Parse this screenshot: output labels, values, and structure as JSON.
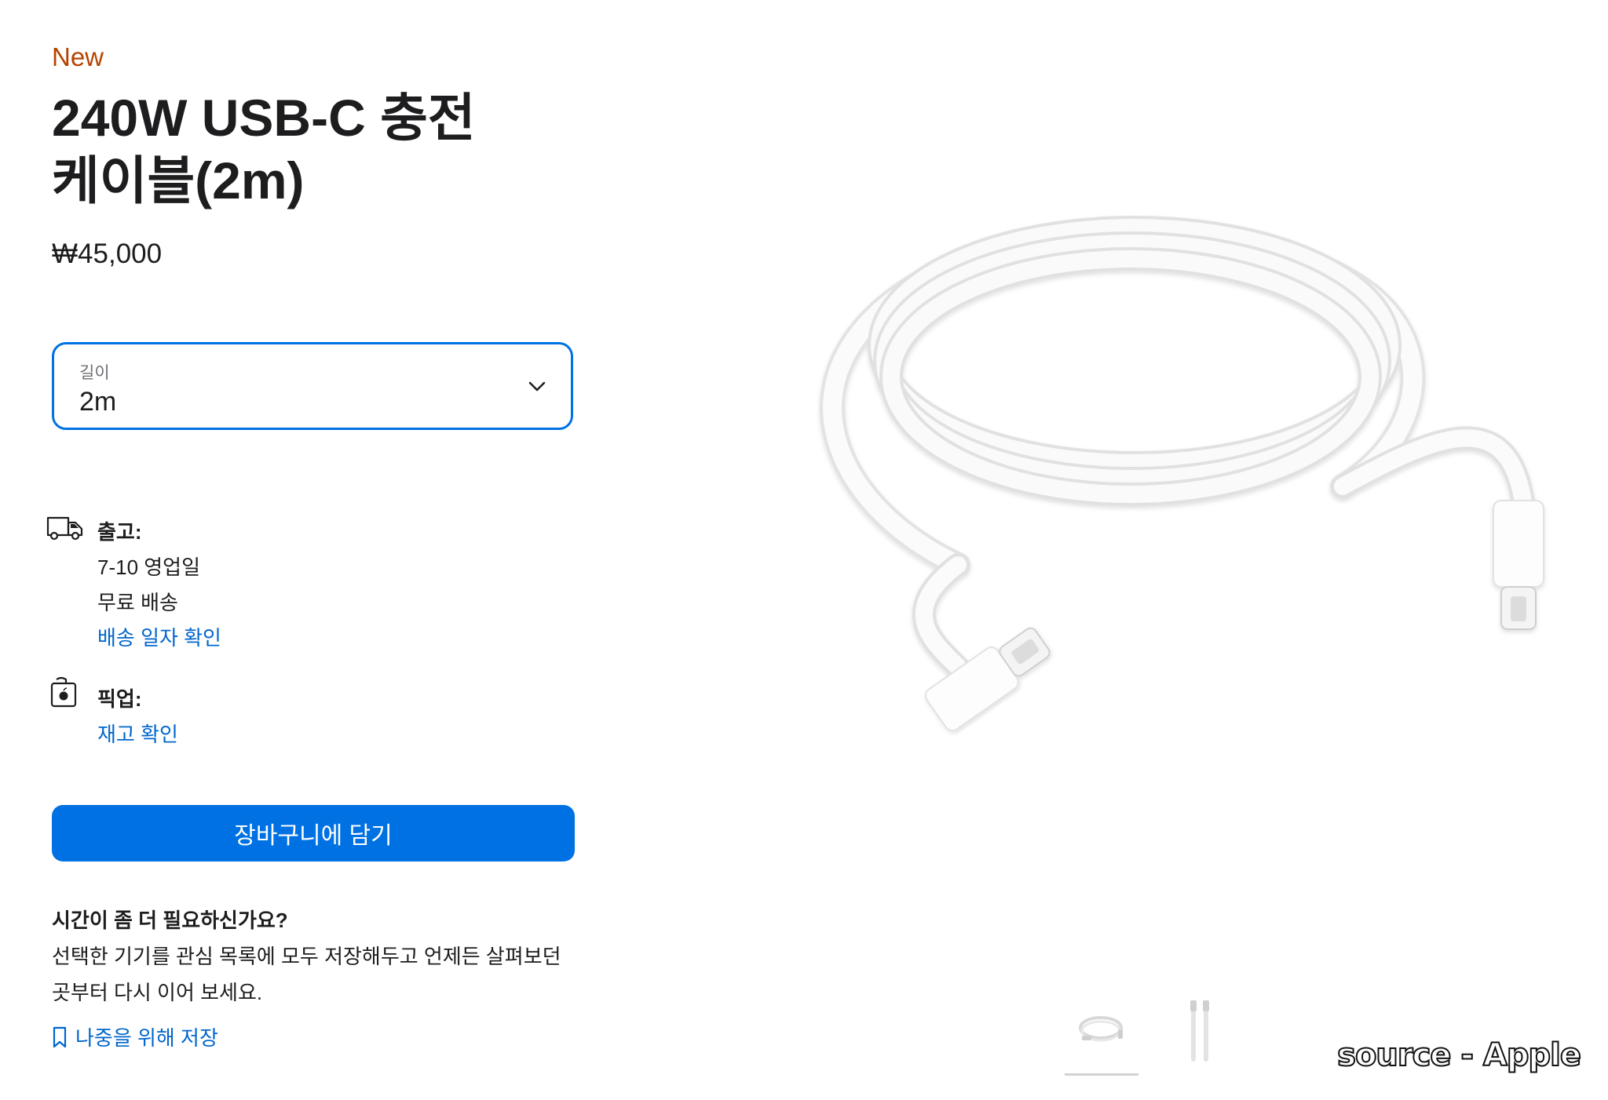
{
  "product": {
    "badge": "New",
    "title_line1": "240W USB-C 충전",
    "title_line2": "케이블(2m)",
    "price": "₩45,000"
  },
  "length_select": {
    "label": "길이",
    "value": "2m"
  },
  "shipping": {
    "title": "출고:",
    "line1": "7-10 영업일",
    "line2": "무료 배송",
    "link": "배송 일자 확인"
  },
  "pickup": {
    "title": "픽업:",
    "link": "재고 확인"
  },
  "cart_button": "장바구니에 담기",
  "save_for_later": {
    "title": "시간이 좀 더 필요하신가요?",
    "desc_line1": "선택한 기기를 관심 목록에 모두 저장해두고 언제든 살펴보던",
    "desc_line2": "곳부터 다시 이어 보세요.",
    "link": "나중을 위해 저장"
  },
  "gallery": {
    "thumbnails": [
      "coiled-cable-thumbnail",
      "straight-cable-thumbnail"
    ]
  },
  "watermark": "source - Apple",
  "colors": {
    "accent": "#0071e3",
    "link": "#0066cc",
    "new_badge": "#b64400"
  }
}
